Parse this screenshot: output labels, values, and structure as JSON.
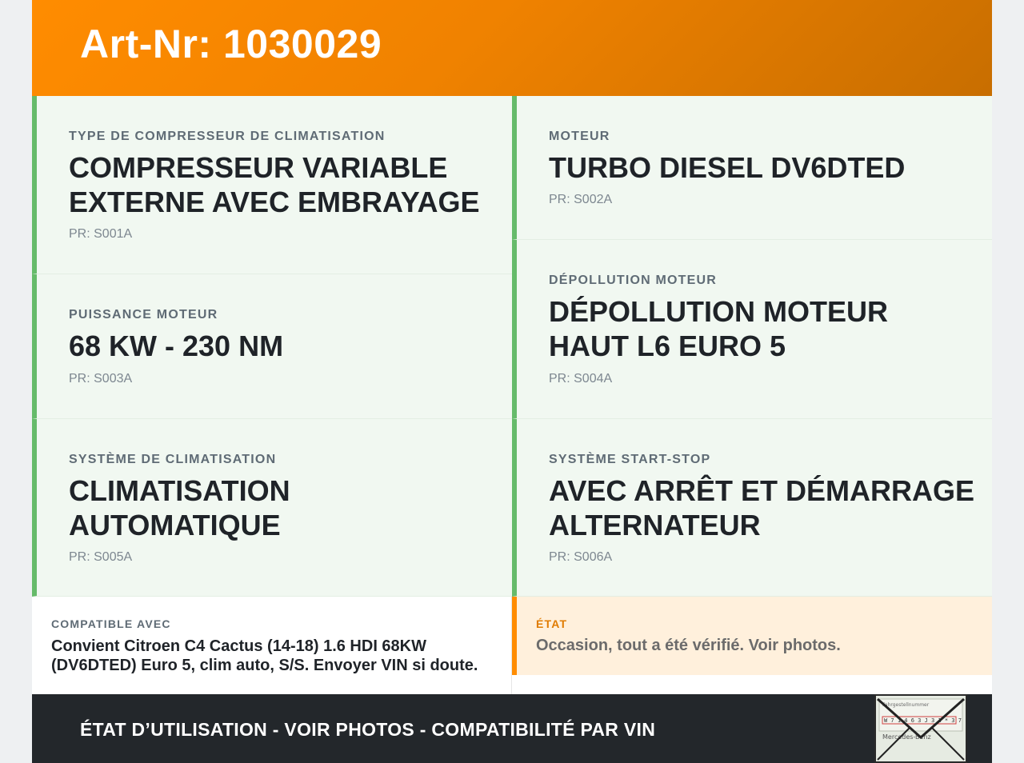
{
  "header": {
    "title": "Art-Nr: 1030029"
  },
  "specs": [
    {
      "label": "TYPE DE COMPRESSEUR DE CLIMATISATION",
      "value": "COMPRESSEUR VARIABLE EXTERNE AVEC EMBRAYAGE",
      "code": "PR: S001A"
    },
    {
      "label": "MOTEUR",
      "value": "TURBO DIESEL DV6DTED",
      "code": "PR: S002A"
    },
    {
      "label": "PUISSANCE MOTEUR",
      "value": "68 KW - 230 NM",
      "code": "PR: S003A"
    },
    {
      "label": "DÉPOLLUTION MOTEUR",
      "value": "DÉPOLLUTION MOTEUR HAUT L6 EURO 5",
      "code": "PR: S004A"
    },
    {
      "label": "SYSTÈME DE CLIMATISATION",
      "value": "CLIMATISATION AUTOMATIQUE",
      "code": "PR: S005A"
    },
    {
      "label": "SYSTÈME START-STOP",
      "value": "AVEC ARRÊT ET DÉMARRAGE ALTERNATEUR",
      "code": "PR: S006A"
    }
  ],
  "compat": {
    "label": "COMPATIBLE AVEC",
    "text": "Convient Citroen C4 Cactus (14-18) 1.6 HDI 68KW (DV6DTED) Euro 5, clim auto, S/S. Envoyer VIN si doute."
  },
  "state": {
    "label": "ÉTAT",
    "text": "Occasion, tout a été vérifié. Voir photos."
  },
  "footer": {
    "text": "ÉTAT D’UTILISATION - VOIR PHOTOS - COMPATIBILITÉ PAR VIN"
  },
  "thumbnail": {
    "lines": [
      "Fahrgestellnummer",
      "W 7 1 4 6 3 J 3 1 * 3 7",
      "Mercedes-Benz"
    ]
  },
  "colors": {
    "header_orange": "#ff8c00",
    "spec_bg": "#f1f8f1",
    "spec_accent_green": "#66bb6a",
    "state_bg": "#fff0dc",
    "footer_bg": "#23272b"
  }
}
